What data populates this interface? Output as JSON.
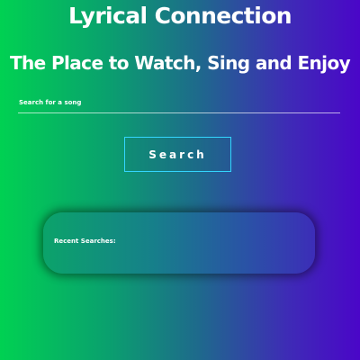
{
  "header": {
    "title": "Lyrical Connection",
    "tagline": "The Place to Watch, Sing and Enjoy"
  },
  "search": {
    "placeholder": "Search for a song",
    "value": "",
    "button_label": "Search"
  },
  "recent": {
    "title": "Recent Searches:",
    "items": []
  },
  "colors": {
    "gradient_start": "#00d152",
    "gradient_end": "#4a06c8",
    "button_border": "#33d6ff",
    "text": "#ffffff"
  }
}
